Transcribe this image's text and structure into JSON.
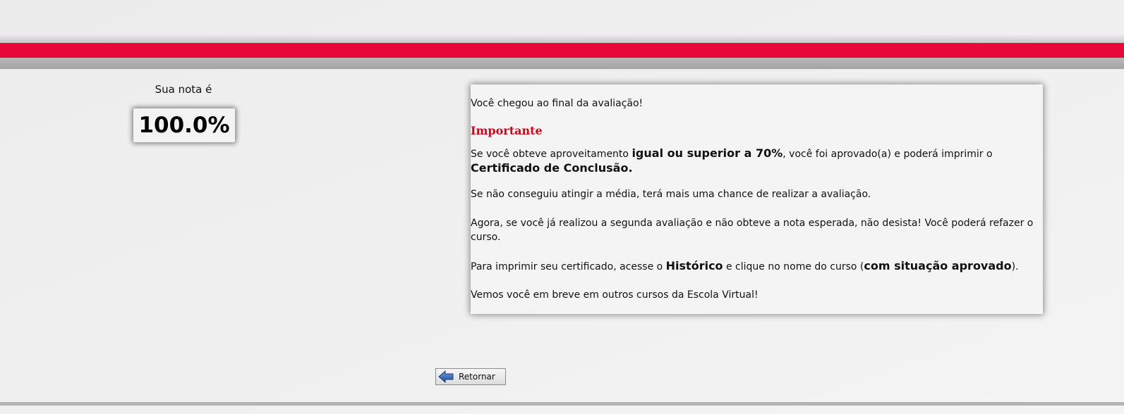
{
  "score": {
    "label": "Sua nota é",
    "value": "100.0%"
  },
  "info": {
    "intro": "Você chegou ao final da avaliação!",
    "important": "Importante",
    "cert_p1": "Se você obteve aproveitamento ",
    "cert_b1": "igual ou superior a 70%",
    "cert_p2": ", você foi aprovado(a) e poderá imprimir o ",
    "cert_b2": "Certificado de Conclusão.",
    "retry": "Se não conseguiu atingir a média, terá mais uma chance de realizar a avaliação.",
    "again": "Agora, se você já realizou a segunda avaliação e não obteve a nota esperada, não desista! Você poderá refazer o curso.",
    "print_p1": "Para imprimir seu certificado, acesse o ",
    "print_b1": "Histórico",
    "print_p2": " e clique no nome do curso (",
    "print_b2": "com situação aprovado",
    "print_p3": ").",
    "farewell": "Vemos você em breve em outros cursos da Escola Virtual!"
  },
  "actions": {
    "return_label": "Retornar",
    "return_icon": "arrow-left-icon"
  },
  "colors": {
    "accent_red": "#e8093a",
    "important_red": "#e10012",
    "icon_blue": "#2d5fa8"
  }
}
